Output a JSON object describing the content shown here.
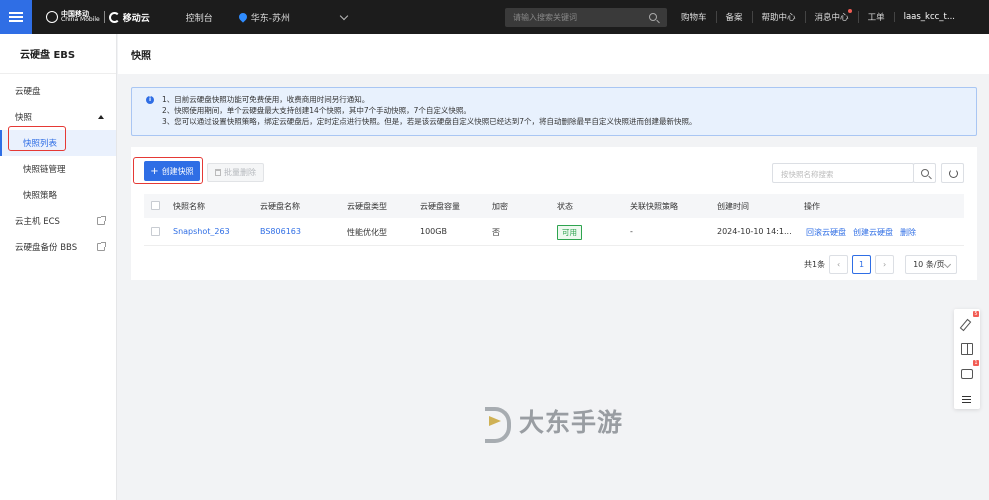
{
  "topbar": {
    "logo_cm_cn": "中国移动",
    "logo_cm_en": "China Mobile",
    "logo_cloud": "移动云",
    "console": "控制台",
    "region": "华东-苏州",
    "search_placeholder": "请输入搜索关键词",
    "links": [
      "购物车",
      "备案",
      "帮助中心",
      "消息中心",
      "工单"
    ],
    "user": "laas_kcc_t..."
  },
  "sidebar": {
    "title": "云硬盘 EBS",
    "items": [
      {
        "label": "云硬盘"
      },
      {
        "label": "快照"
      },
      {
        "label": "快照列表"
      },
      {
        "label": "快照链管理"
      },
      {
        "label": "快照策略"
      },
      {
        "label": "云主机 ECS"
      },
      {
        "label": "云硬盘备份 BBS"
      }
    ]
  },
  "page": {
    "title": "快照"
  },
  "notice": {
    "lines": [
      "1、目前云硬盘快照功能可免费使用，收费商用时间另行通知。",
      "2、快照使用期间，单个云硬盘最大支持创建14个快照，其中7个手动快照，7个自定义快照。",
      "3、您可以通过设置快照策略，绑定云硬盘后，定时定点进行快照。但是，若是该云硬盘自定义快照已经达到7个，将自动删除最早自定义快照进而创建最新快照。"
    ]
  },
  "toolbar": {
    "create_label": "创建快照",
    "batch_delete_label": "批量删除",
    "search_placeholder": "按快照名称搜索"
  },
  "table": {
    "columns": [
      "快照名称",
      "云硬盘名称",
      "云硬盘类型",
      "云硬盘容量",
      "加密",
      "状态",
      "关联快照策略",
      "创建时间",
      "操作"
    ],
    "rows": [
      {
        "name": "Snapshot_263",
        "disk_name": "BS806163",
        "disk_type": "性能优化型",
        "capacity": "100GB",
        "encrypted": "否",
        "status": "可用",
        "policy": "-",
        "created": "2024-10-10 14:1...",
        "ops": [
          "回滚云硬盘",
          "创建云硬盘",
          "删除"
        ]
      }
    ]
  },
  "pager": {
    "total": "共1条",
    "current": "1",
    "size": "10 条/页"
  },
  "float_tools": {
    "badge_1": "5",
    "badge_2": "1"
  },
  "watermark": {
    "text": "大东手游"
  },
  "colors": {
    "primary": "#2f6ee5",
    "success": "#2ea44f",
    "highlight": "#e53935"
  }
}
